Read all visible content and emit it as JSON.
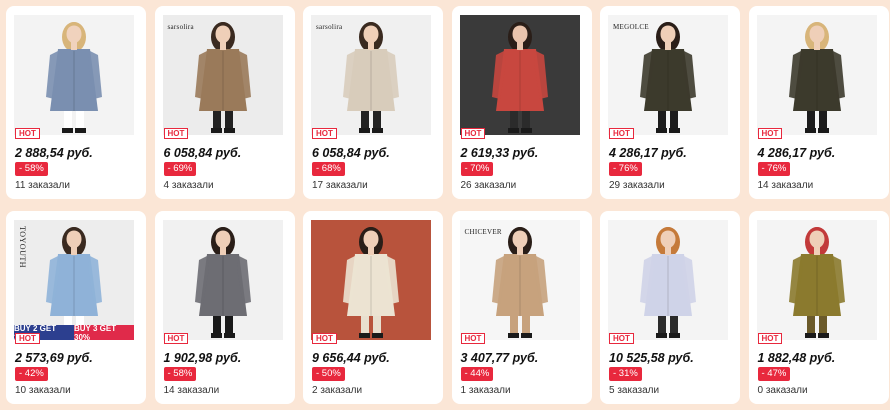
{
  "hot_label": "HOT",
  "colors": {
    "page_background": "#fbe6d6",
    "hot_red": "#e8283d",
    "discount_red": "#e8283d"
  },
  "products": [
    {
      "price": "2 888,54 руб.",
      "discount": "- 58%",
      "orders": "11 заказали",
      "image_bg": "#f3f3f3",
      "coat": "#7a8fb0",
      "hair": "#d8b57a",
      "skin": "#f0d2bd",
      "pants": "#ffffff",
      "brand": ""
    },
    {
      "price": "6 058,84 руб.",
      "discount": "- 69%",
      "orders": "4 заказали",
      "image_bg": "#ececec",
      "coat": "#9a7a5a",
      "hair": "#3a2a20",
      "skin": "#efcfb8",
      "pants": "#222222",
      "brand": "sarsolira"
    },
    {
      "price": "6 058,84 руб.",
      "discount": "- 68%",
      "orders": "17 заказали",
      "image_bg": "#f0f0f0",
      "coat": "#d8ccbb",
      "hair": "#3a2a20",
      "skin": "#efcfb8",
      "pants": "#222222",
      "brand": "sarsolira"
    },
    {
      "price": "2 619,33 руб.",
      "discount": "- 70%",
      "orders": "26 заказали",
      "image_bg": "#3a3a3a",
      "coat": "#c8473f",
      "hair": "#2a1e18",
      "skin": "#e9c4ad",
      "pants": "#2b2b2b",
      "brand": ""
    },
    {
      "price": "4 286,17 руб.",
      "discount": "- 76%",
      "orders": "29 заказали",
      "image_bg": "#f4f4f4",
      "coat": "#3c3a2c",
      "hair": "#2a1e18",
      "skin": "#efcfb8",
      "pants": "#1c1c1c",
      "brand": "MEGOLCE"
    },
    {
      "price": "4 286,17 руб.",
      "discount": "- 76%",
      "orders": "14 заказали",
      "image_bg": "#f4f4f4",
      "coat": "#3c3a2c",
      "hair": "#d8b57a",
      "skin": "#efcfb8",
      "pants": "#1c1c1c",
      "brand": ""
    },
    {
      "price": "2 573,69 руб.",
      "discount": "- 42%",
      "orders": "10 заказали",
      "image_bg": "#ededed",
      "coat": "#8fb2d8",
      "hair": "#3a2a20",
      "skin": "#efcfb8",
      "pants": "#ffffff",
      "brand": "TOYOUTH",
      "promo": [
        "BUY 2 GET 20%",
        "BUY 3 GET 30%"
      ]
    },
    {
      "price": "1 902,98 руб.",
      "discount": "- 58%",
      "orders": "14 заказали",
      "image_bg": "#f1f1f1",
      "coat": "#6d6d73",
      "hair": "#2a1e18",
      "skin": "#efcfb8",
      "pants": "#1a1a1a",
      "brand": ""
    },
    {
      "price": "9 656,44 руб.",
      "discount": "- 50%",
      "orders": "2 заказали",
      "image_bg": "#b8533c",
      "coat": "#ece3d2",
      "hair": "#2a1e18",
      "skin": "#efcfb8",
      "pants": "#e8dfcf",
      "brand": ""
    },
    {
      "price": "3 407,77 руб.",
      "discount": "- 44%",
      "orders": "1 заказали",
      "image_bg": "#f6f6f6",
      "coat": "#c7a27d",
      "hair": "#2a1e18",
      "skin": "#efcfb8",
      "pants": "#c7a27d",
      "brand": "CHICEVER"
    },
    {
      "price": "10 525,58 руб.",
      "discount": "- 31%",
      "orders": "5 заказали",
      "image_bg": "#f4f4f4",
      "coat": "#cfd3e8",
      "hair": "#c57a3a",
      "skin": "#efcfb8",
      "pants": "#2b2b2b",
      "brand": ""
    },
    {
      "price": "1 882,48 руб.",
      "discount": "- 47%",
      "orders": "0 заказали",
      "image_bg": "#f4f4f4",
      "coat": "#8b7a2e",
      "hair": "#c23a3a",
      "skin": "#efcfb8",
      "pants": "#6b5a2a",
      "brand": ""
    }
  ]
}
